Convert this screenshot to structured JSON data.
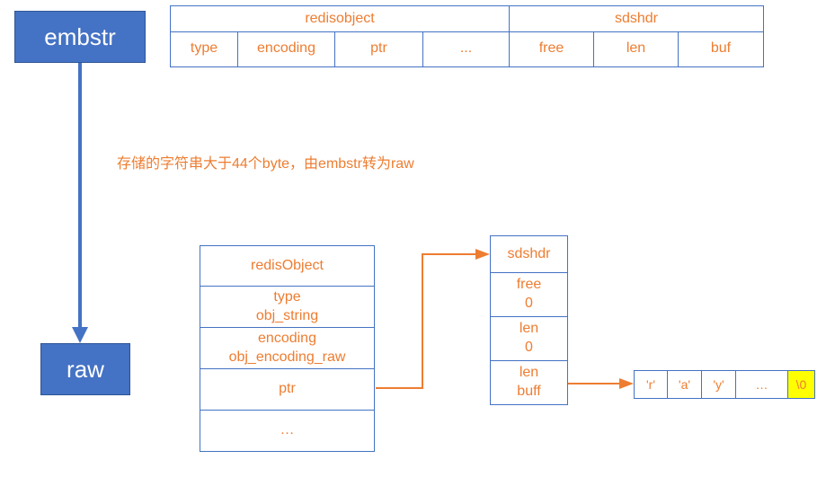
{
  "embstr": {
    "label": "embstr"
  },
  "raw": {
    "label": "raw"
  },
  "top_table": {
    "redisobject_header": "redisobject",
    "sdshdr_header": "sdshdr",
    "cells": {
      "type": "type",
      "encoding": "encoding",
      "ptr": "ptr",
      "ellipsis": "...",
      "free": "free",
      "len": "len",
      "buf": "buf"
    }
  },
  "annotation_text": "存储的字符串大于44个byte，由embstr转为raw",
  "redis_object_stack": {
    "header": "redisObject",
    "type_label": "type",
    "type_value": "obj_string",
    "encoding_label": "encoding",
    "encoding_value": "obj_encoding_raw",
    "ptr": "ptr",
    "ellipsis": "…"
  },
  "sdshdr_stack": {
    "header": "sdshdr",
    "free_label": "free",
    "free_value": "0",
    "len_label": "len",
    "len_value": "0",
    "buf_label": "len",
    "buf_sub": "buff"
  },
  "buffer": {
    "c0": "'r'",
    "c1": "'a'",
    "c2": "'y'",
    "c3": "…",
    "c4": "\\0"
  }
}
